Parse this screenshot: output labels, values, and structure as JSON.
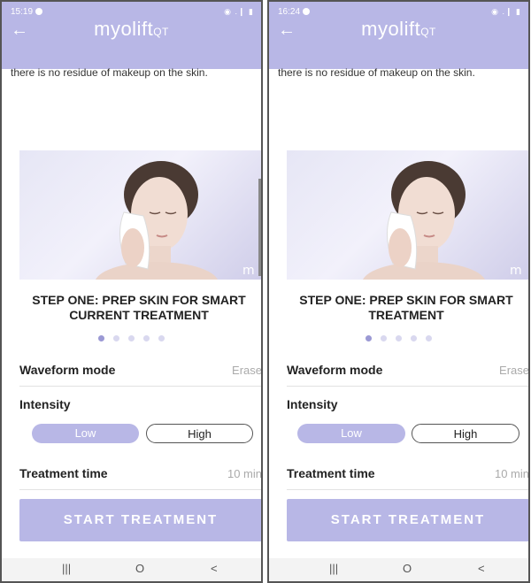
{
  "colors": {
    "brand_purple": "#b8b7e6",
    "dot_active": "#9b99d4",
    "dot_inactive": "#d9d8ef"
  },
  "phones": [
    {
      "status_time": "15:19",
      "top_text": "there is no residue of makeup on the skin.",
      "step_title": "STEP ONE: PREP SKIN FOR SMART CURRENT TREATMENT",
      "waveform_value": "Erase",
      "treatment_time_value": "10 min"
    },
    {
      "status_time": "16:24",
      "top_text": "there is no residue of makeup on the skin.",
      "step_title": "STEP ONE: PREP SKIN FOR SMART TREATMENT",
      "waveform_value": "Erase",
      "treatment_time_value": "10 min"
    }
  ],
  "app": {
    "logo_main": "myolift",
    "logo_sub": "QT",
    "back_icon": "←",
    "hero_mark": "m",
    "waveform_label": "Waveform mode",
    "intensity_label": "Intensity",
    "intensity_options": [
      "Low",
      "High"
    ],
    "intensity_selected": "Low",
    "treatment_time_label": "Treatment time",
    "start_button": "START TREATMENT",
    "status_icons": "◉ .❙ ▮"
  },
  "carousel": {
    "count": 5,
    "active_index": 0
  },
  "navbar": {
    "recents_icon": "|||",
    "home_icon": "O",
    "back_icon": "<"
  }
}
